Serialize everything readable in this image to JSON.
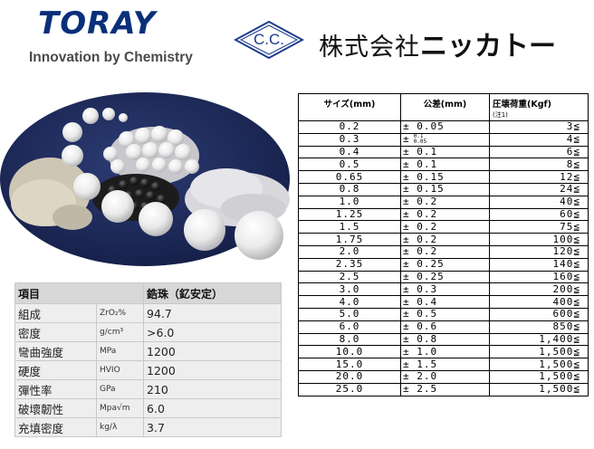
{
  "logos": {
    "toray_brand": "TORAY",
    "toray_tagline": "Innovation by Chemistry",
    "cc_mark": "C.C.",
    "company_name_kanji": "株式会社",
    "company_name_kana": "ニッカトー"
  },
  "colors": {
    "toray_blue": "#0a2f7a",
    "cc_blue": "#1b3d8c",
    "photo_background": "#1a2a5c",
    "props_header_bg": "#d7d7d7",
    "props_cell_bg": "#eeeeee"
  },
  "properties_table": {
    "header_left": "項目",
    "header_right": "鋯珠（釔安定）",
    "rows": [
      {
        "name": "組成",
        "unit": "ZrO₂%",
        "value": "94.7"
      },
      {
        "name": "密度",
        "unit": "g/cm³",
        "value": ">6.0"
      },
      {
        "name": "彎曲強度",
        "unit": "MPa",
        "value": "1200"
      },
      {
        "name": "硬度",
        "unit": "HVIO",
        "value": "1200"
      },
      {
        "name": "彈性率",
        "unit": "GPa",
        "value": "210"
      },
      {
        "name": "破壞韌性",
        "unit": "Mpa√m",
        "value": "6.0"
      },
      {
        "name": "充填密度",
        "unit": "kg/λ",
        "value": "3.7"
      }
    ]
  },
  "size_table": {
    "header_size": "サイズ(mm)",
    "header_tolerance": "公差(mm)",
    "header_load": "圧壊荷重(Kgf)",
    "header_load_note": "(注1)",
    "rows": [
      {
        "size": "0.2",
        "tolerance": "± 0.05",
        "load": "3≦"
      },
      {
        "size": "0.3",
        "tolerance": "±",
        "tolerance_upper": "0.1",
        "tolerance_lower": "0.05",
        "load": "4≦"
      },
      {
        "size": "0.4",
        "tolerance": "± 0.1",
        "load": "6≦"
      },
      {
        "size": "0.5",
        "tolerance": "± 0.1",
        "load": "8≦"
      },
      {
        "size": "0.65",
        "tolerance": "± 0.15",
        "load": "12≦"
      },
      {
        "size": "0.8",
        "tolerance": "± 0.15",
        "load": "24≦"
      },
      {
        "size": "1.0",
        "tolerance": "± 0.2",
        "load": "40≦"
      },
      {
        "size": "1.25",
        "tolerance": "± 0.2",
        "load": "60≦"
      },
      {
        "size": "1.5",
        "tolerance": "± 0.2",
        "load": "75≦"
      },
      {
        "size": "1.75",
        "tolerance": "± 0.2",
        "load": "100≦"
      },
      {
        "size": "2.0",
        "tolerance": "± 0.2",
        "load": "120≦"
      },
      {
        "size": "2.35",
        "tolerance": "± 0.25",
        "load": "140≦"
      },
      {
        "size": "2.5",
        "tolerance": "± 0.25",
        "load": "160≦"
      },
      {
        "size": "3.0",
        "tolerance": "± 0.3",
        "load": "200≦"
      },
      {
        "size": "4.0",
        "tolerance": "± 0.4",
        "load": "400≦"
      },
      {
        "size": "5.0",
        "tolerance": "± 0.5",
        "load": "600≦"
      },
      {
        "size": "6.0",
        "tolerance": "± 0.6",
        "load": "850≦"
      },
      {
        "size": "8.0",
        "tolerance": "± 0.8",
        "load": "1,400≦"
      },
      {
        "size": "10.0",
        "tolerance": "± 1.0",
        "load": "1,500≦"
      },
      {
        "size": "15.0",
        "tolerance": "± 1.5",
        "load": "1,500≦"
      },
      {
        "size": "20.0",
        "tolerance": "± 2.0",
        "load": "1,500≦"
      },
      {
        "size": "25.0",
        "tolerance": "± 2.5",
        "load": "1,500≦"
      }
    ]
  }
}
